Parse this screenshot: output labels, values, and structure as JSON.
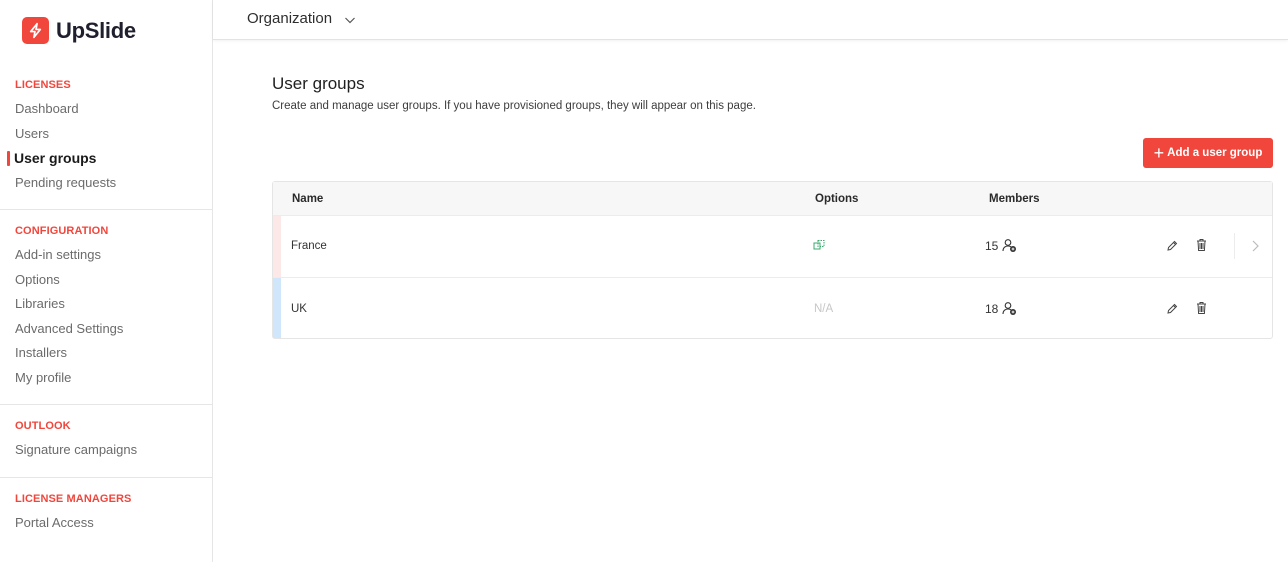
{
  "brand": {
    "name": "UpSlide",
    "accent": "#f0463c"
  },
  "sidebar": {
    "sections": [
      {
        "heading": "LICENSES",
        "items": [
          "Dashboard",
          "Users",
          "User groups",
          "Pending requests"
        ]
      },
      {
        "heading": "CONFIGURATION",
        "items": [
          "Add-in settings",
          "Options",
          "Libraries",
          "Advanced Settings",
          "Installers",
          "My profile"
        ]
      },
      {
        "heading": "OUTLOOK",
        "items": [
          "Signature campaigns"
        ]
      },
      {
        "heading": "LICENSE MANAGERS",
        "items": [
          "Portal Access"
        ]
      }
    ],
    "active_item": "User groups"
  },
  "topbar": {
    "org_label": "Organization",
    "icon": "chevron-down-icon"
  },
  "main": {
    "title": "User groups",
    "description": "Create and manage user groups. If you have provisioned groups, they will appear on this page.",
    "add_button_label": "Add a user group"
  },
  "table": {
    "columns": [
      "Name",
      "Options",
      "Members"
    ],
    "rows": [
      {
        "name": "France",
        "options": "",
        "options_icon": "sync-icon",
        "members": "15",
        "accent": "#fde8e8",
        "has_expand": true
      },
      {
        "name": "UK",
        "options": "N/A",
        "options_icon": "",
        "members": "18",
        "accent": "#cfe6fb",
        "has_expand": false
      }
    ]
  },
  "colors": {
    "primary": "#f0463c",
    "text_muted": "#6b6b6b",
    "option_icon": "#3aa86b"
  }
}
